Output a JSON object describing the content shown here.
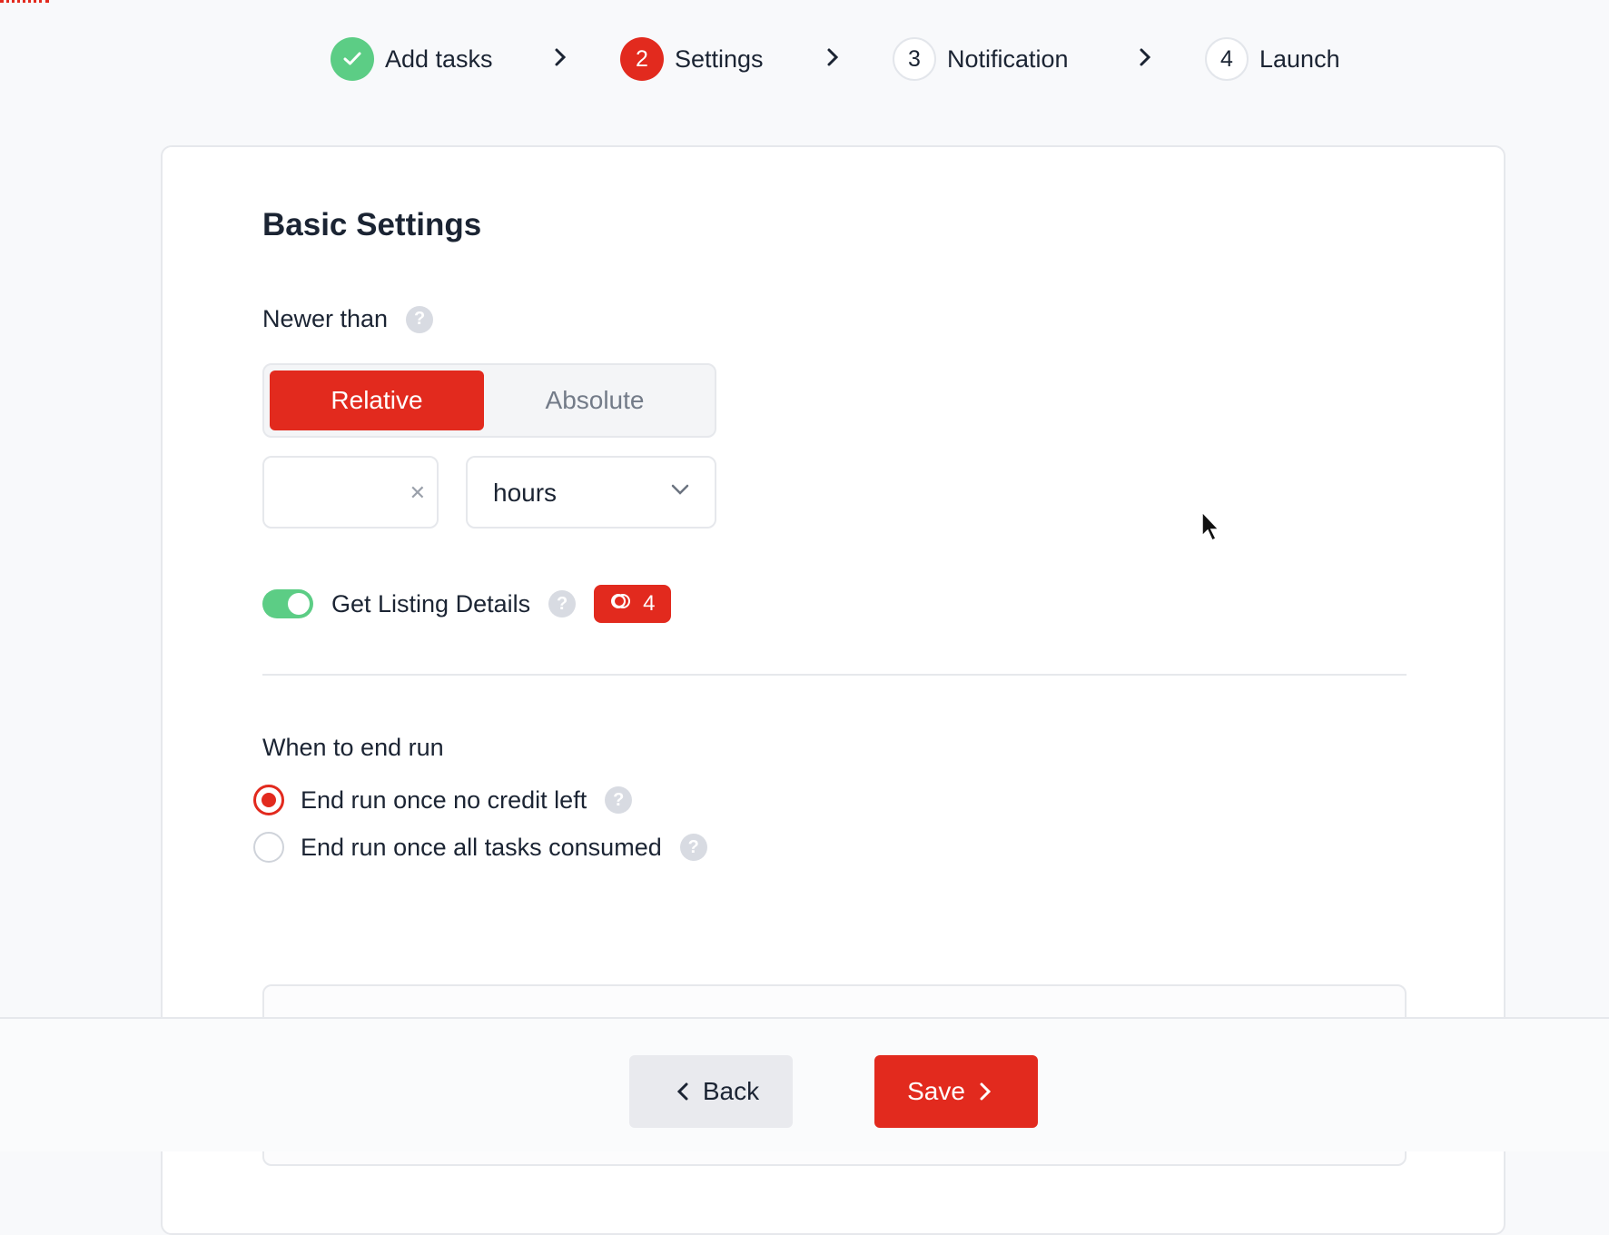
{
  "stepper": {
    "steps": [
      {
        "number": "",
        "label": "Add tasks",
        "state": "done",
        "icon": "check-icon"
      },
      {
        "number": "2",
        "label": "Settings",
        "state": "active"
      },
      {
        "number": "3",
        "label": "Notification",
        "state": "pending"
      },
      {
        "number": "4",
        "label": "Launch",
        "state": "pending"
      }
    ]
  },
  "basic_settings": {
    "title": "Basic Settings",
    "newer_than": {
      "label": "Newer than",
      "modes": [
        "Relative",
        "Absolute"
      ],
      "selected_mode": "Relative",
      "amount_value": "",
      "unit_value": "hours"
    },
    "listing_details": {
      "label": "Get Listing Details",
      "enabled": true,
      "credit_cost": "4"
    }
  },
  "end_run": {
    "label": "When to end run",
    "options": [
      {
        "label": "End run once no credit left",
        "checked": true
      },
      {
        "label": "End run once all tasks consumed",
        "checked": false
      }
    ]
  },
  "footer": {
    "back_label": "Back",
    "save_label": "Save"
  },
  "colors": {
    "accent": "#e22a1e",
    "success": "#5ccd85",
    "muted": "#d8dbe2"
  }
}
